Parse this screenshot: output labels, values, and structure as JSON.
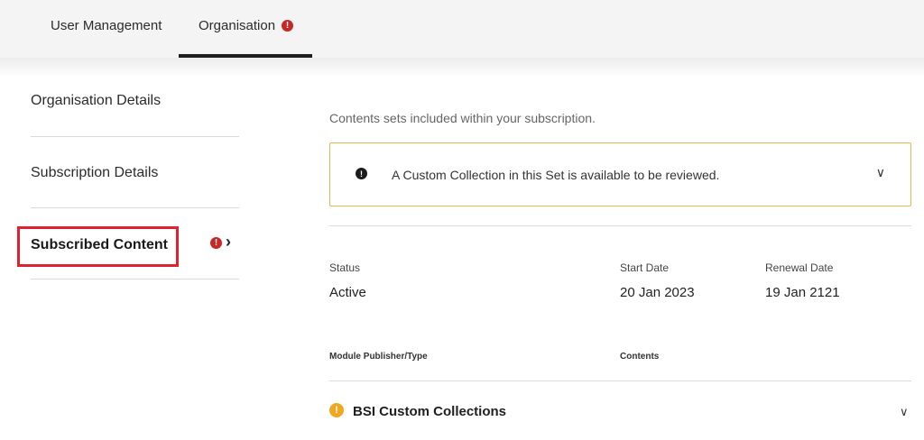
{
  "tabs": [
    {
      "label": "User Management"
    },
    {
      "label": "Organisation",
      "badge": "!"
    }
  ],
  "sidebar": {
    "items": [
      {
        "label": "Organisation Details"
      },
      {
        "label": "Subscription Details"
      },
      {
        "label": "Subscribed Content",
        "badge": "!",
        "chevron": "›"
      }
    ]
  },
  "main": {
    "intro": "Contents sets included within your subscription.",
    "alert": {
      "icon": "!",
      "text": "A Custom Collection in this Set is available to be reviewed.",
      "chevron": "∨"
    },
    "info": {
      "status_label": "Status",
      "status_value": "Active",
      "start_label": "Start Date",
      "start_value": "20 Jan 2023",
      "renewal_label": "Renewal Date",
      "renewal_value": "19 Jan 2121"
    },
    "columns": {
      "publisher": "Module Publisher/Type",
      "contents": "Contents"
    },
    "rows": [
      {
        "icon": "!",
        "title": "BSI Custom Collections",
        "chevron": "∨"
      }
    ]
  },
  "colors": {
    "accent_red": "#e0212f",
    "badge_red": "#c62828",
    "warning": "#f0a820",
    "alert_border": "#e8b64a"
  },
  "icons": [
    "info-badge-icon",
    "chevron-right-icon",
    "info-icon",
    "chevron-down-icon",
    "warning-icon"
  ]
}
